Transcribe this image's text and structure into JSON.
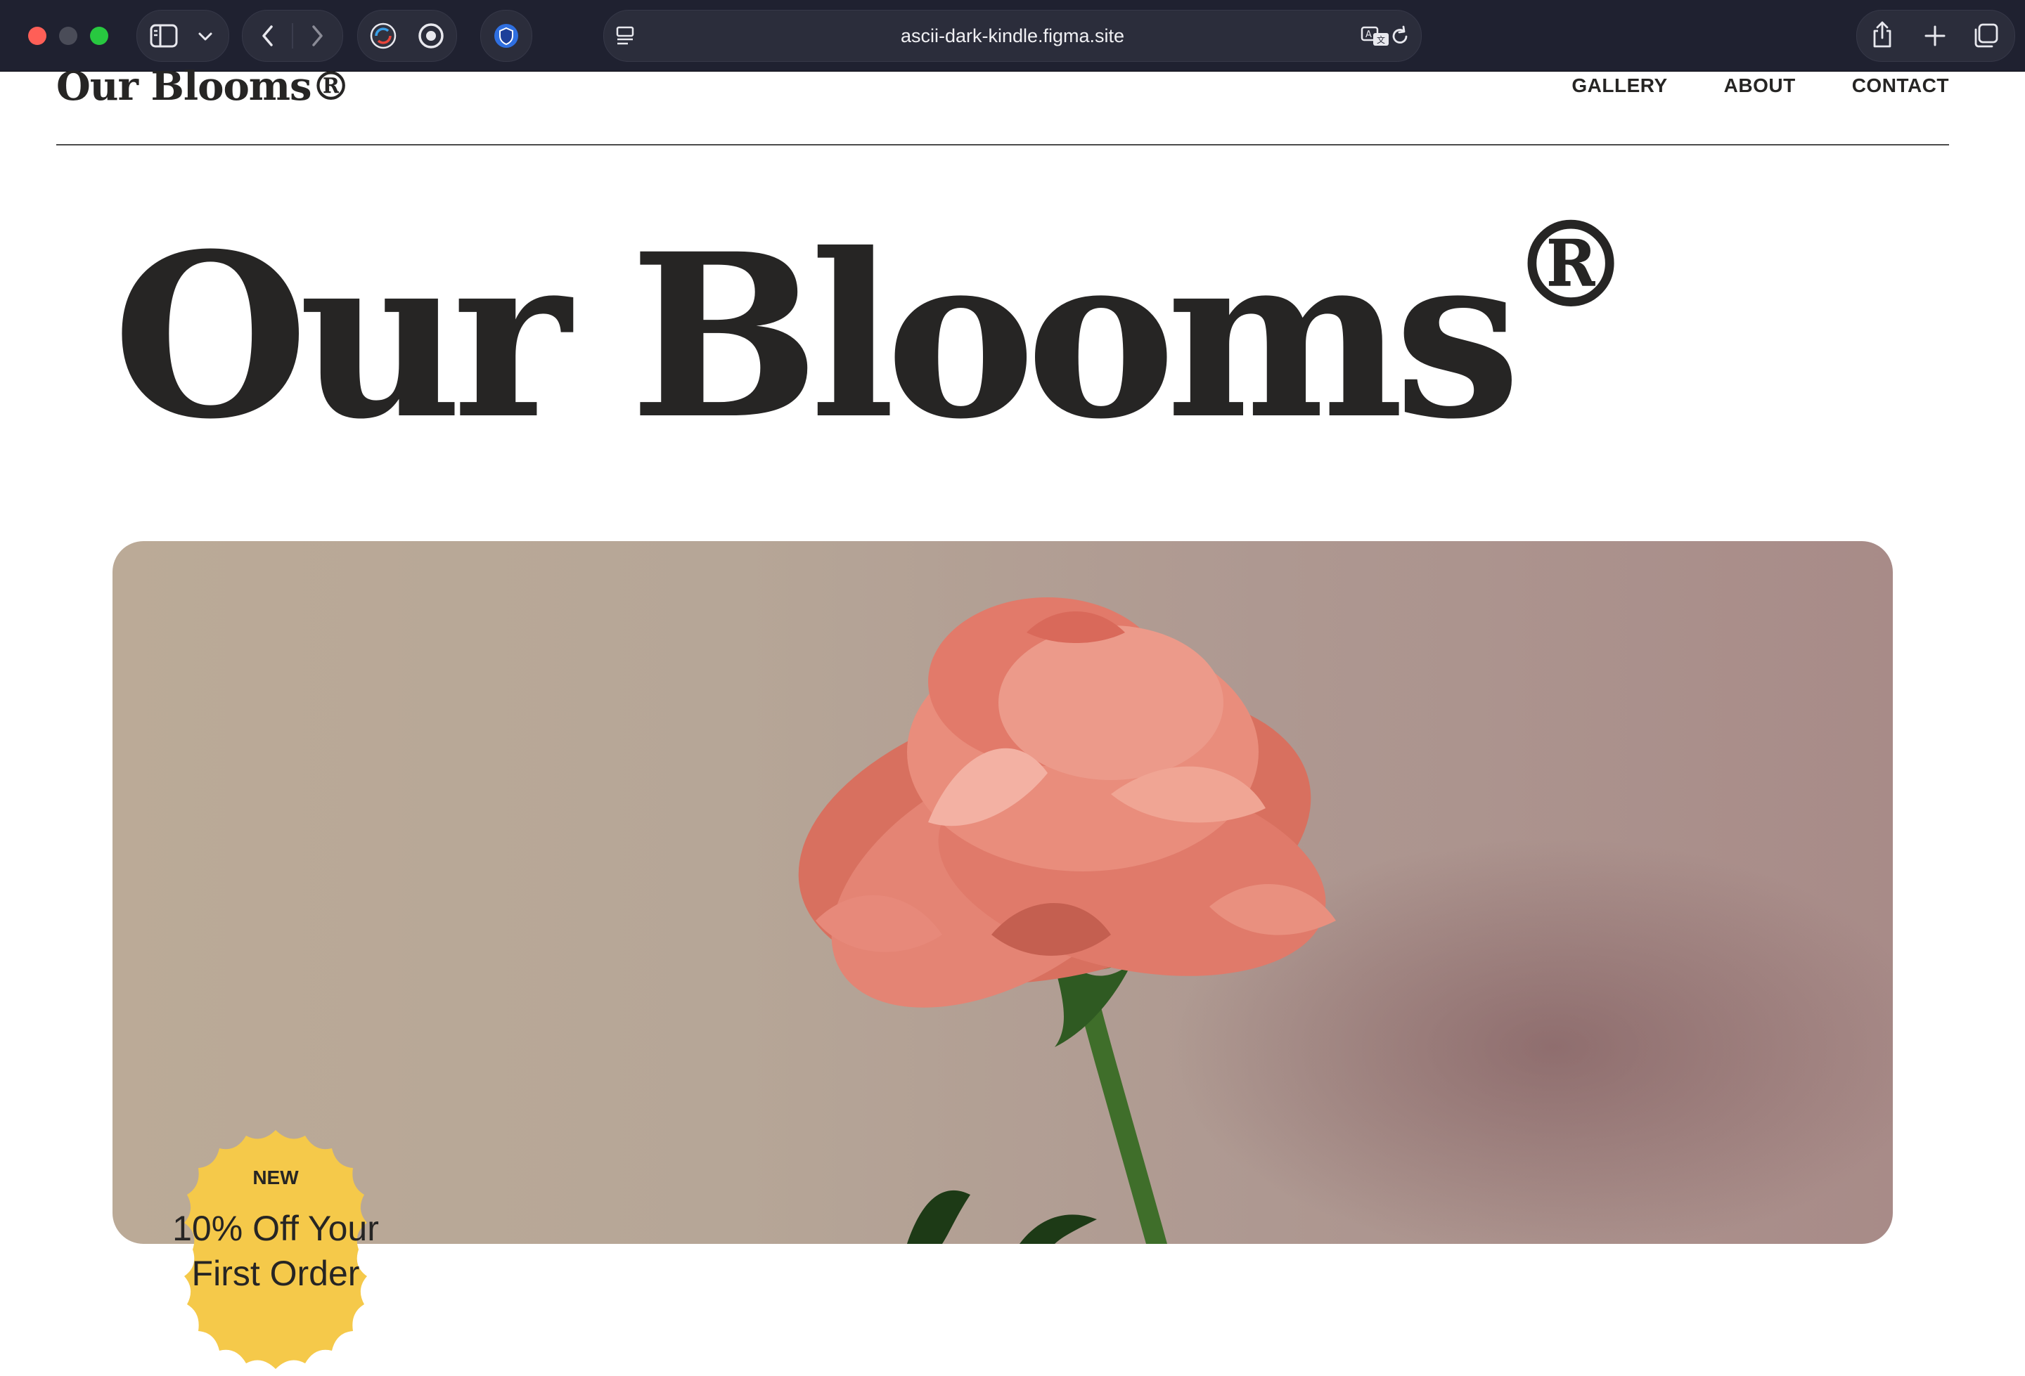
{
  "browser": {
    "url": "ascii-dark-kindle.figma.site",
    "icons": [
      "sidebar-icon",
      "chevron-down-icon",
      "back-icon",
      "forward-icon",
      "sync-icon",
      "record-icon",
      "shield-icon",
      "reader-icon",
      "translate-icon",
      "reload-icon",
      "share-icon",
      "new-tab-icon",
      "tabs-overview-icon"
    ]
  },
  "header": {
    "logo": "Our Blooms®",
    "nav": [
      "GALLERY",
      "ABOUT",
      "CONTACT"
    ]
  },
  "hero": {
    "title": "Our Blooms",
    "title_mark": "®"
  },
  "badge": {
    "label": "NEW",
    "text_line1": "10% Off Your",
    "text_line2": "First Order",
    "color": "#f5c94a"
  },
  "colors": {
    "ink": "#262524",
    "chrome": "#1f2130",
    "flower": "#e37a6c",
    "stem": "#3f6e2a"
  }
}
